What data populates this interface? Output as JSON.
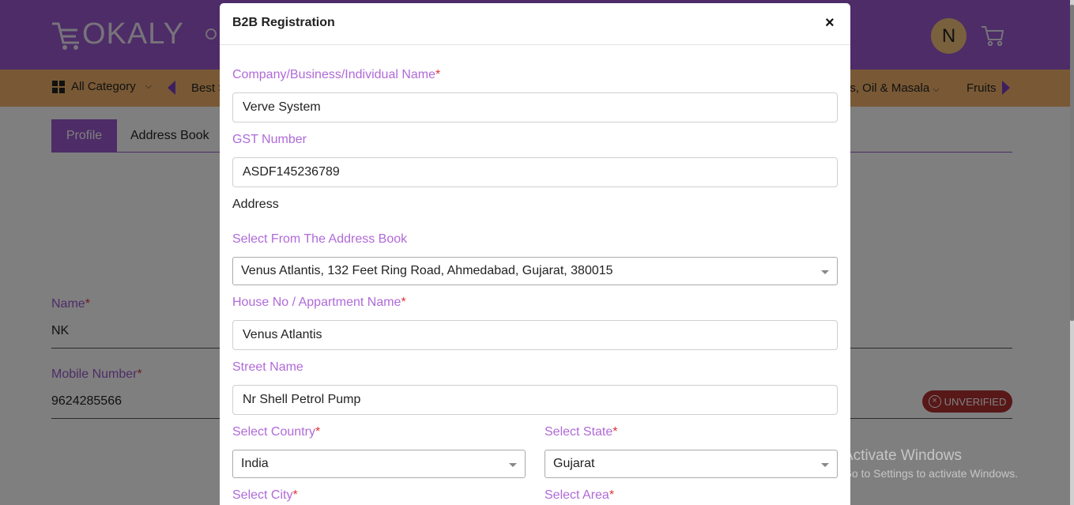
{
  "header": {
    "logo_text": "OKALY",
    "avatar_initial": "N"
  },
  "category_bar": {
    "all_category_label": "All Category",
    "items": [
      "Best S",
      "ns, Oil & Masala",
      "Fruits"
    ]
  },
  "profile_tabs": {
    "profile": "Profile",
    "address_book": "Address Book"
  },
  "profile_fields": {
    "name_label": "Name",
    "name_value": "NK",
    "mobile_label": "Mobile Number",
    "mobile_value": "9624285566",
    "status_badge": "UNVERIFIED",
    "required_mark": "*"
  },
  "modal": {
    "title": "B2B Registration",
    "close_symbol": "×",
    "fields": {
      "company_label": "Company/Business/Individual Name",
      "company_value": "Verve System",
      "gst_label": "GST Number",
      "gst_value": "ASDF145236789",
      "address_heading": "Address",
      "address_book_label": "Select From The Address Book",
      "address_book_value": "Venus Atlantis, 132 Feet Ring Road, Ahmedabad, Gujarat, 380015",
      "house_label": "House No / Appartment Name",
      "house_value": "Venus Atlantis",
      "street_label": "Street Name",
      "street_value": "Nr Shell Petrol Pump",
      "country_label": "Select Country",
      "country_value": "India",
      "state_label": "Select State",
      "state_value": "Gujarat",
      "city_label": "Select City",
      "area_label": "Select Area",
      "required_mark": "*"
    }
  },
  "watermark": {
    "title": "Activate Windows",
    "subtitle": "Go to Settings to activate Windows."
  },
  "colors": {
    "brand_purple": "#9b59cf",
    "category_orange": "#f3b26a",
    "label_purple": "#b06ad8",
    "unverified_red": "#b03030"
  }
}
